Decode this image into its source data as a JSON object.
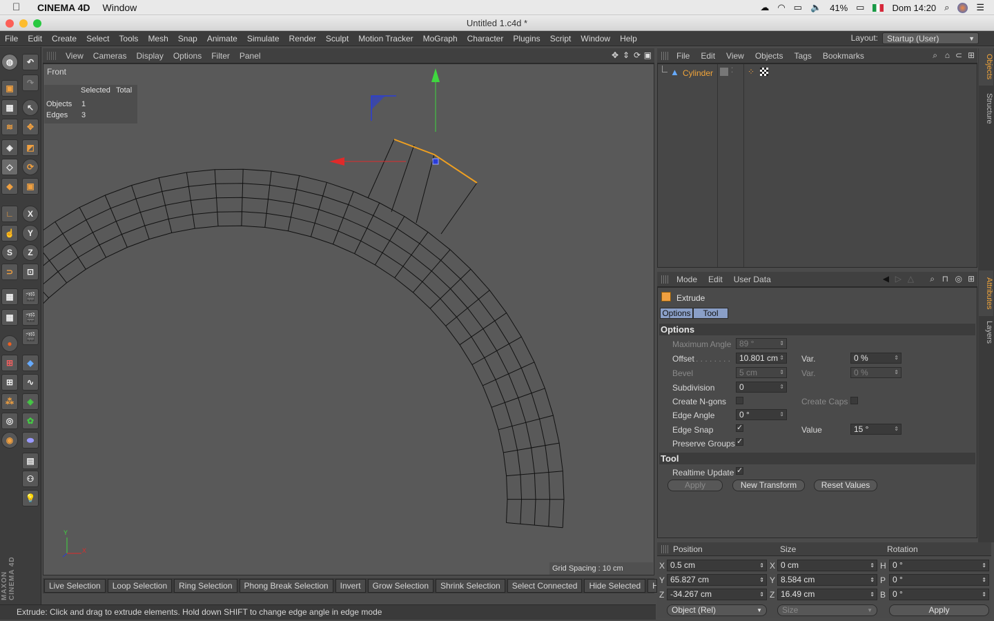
{
  "macos": {
    "app_name": "CINEMA 4D",
    "menu": [
      "Window"
    ],
    "battery": "41%",
    "clock": "Dom 14:20"
  },
  "window": {
    "title": "Untitled 1.c4d *"
  },
  "app_menu": {
    "items": [
      "File",
      "Edit",
      "Create",
      "Select",
      "Tools",
      "Mesh",
      "Snap",
      "Animate",
      "Simulate",
      "Render",
      "Sculpt",
      "Motion Tracker",
      "MoGraph",
      "Character",
      "Plugins",
      "Script",
      "Window",
      "Help"
    ],
    "layout_label": "Layout:",
    "layout_value": "Startup (User)"
  },
  "viewport": {
    "menu": [
      "View",
      "Cameras",
      "Display",
      "Options",
      "Filter",
      "Panel"
    ],
    "name": "Front",
    "stats": {
      "header_selected": "Selected",
      "header_total": "Total",
      "rows": [
        {
          "label": "Objects",
          "selected": "1"
        },
        {
          "label": "Edges",
          "selected": "3"
        }
      ]
    },
    "grid_spacing": "Grid Spacing : 10 cm",
    "axis_y": "Y",
    "axis_x": "X"
  },
  "selection_toolbar": [
    "Live Selection",
    "Loop Selection",
    "Ring Selection",
    "Phong Break Selection",
    "Invert",
    "Grow Selection",
    "Shrink Selection",
    "Select Connected",
    "Hide Selected",
    "Hide"
  ],
  "status_bar": "Extrude: Click and drag to extrude elements. Hold down SHIFT to change edge angle in edge mode",
  "object_manager": {
    "menu": [
      "File",
      "Edit",
      "View",
      "Objects",
      "Tags",
      "Bookmarks"
    ],
    "objects": [
      {
        "name": "Cylinder"
      }
    ]
  },
  "attributes": {
    "menu": [
      "Mode",
      "Edit",
      "User Data"
    ],
    "tool_name": "Extrude",
    "tabs": [
      "Options",
      "Tool"
    ],
    "section_options": "Options",
    "section_tool": "Tool",
    "params": {
      "max_angle_label": "Maximum Angle",
      "max_angle": "89 °",
      "offset_label": "Offset",
      "offset": "10.801 cm",
      "offset_var_label": "Var.",
      "offset_var": "0 %",
      "bevel_label": "Bevel",
      "bevel": "5 cm",
      "bevel_var_label": "Var.",
      "bevel_var": "0 %",
      "subdivision_label": "Subdivision",
      "subdivision": "0",
      "create_ngons_label": "Create N-gons",
      "create_caps_label": "Create Caps",
      "edge_angle_label": "Edge Angle",
      "edge_angle": "0 °",
      "edge_snap_label": "Edge Snap",
      "edge_snap_value_label": "Value",
      "edge_snap_value": "15 °",
      "preserve_groups_label": "Preserve Groups",
      "realtime_update_label": "Realtime Update"
    },
    "buttons": {
      "apply": "Apply",
      "new_transform": "New Transform",
      "reset_values": "Reset Values"
    }
  },
  "coordinates": {
    "head_position": "Position",
    "head_size": "Size",
    "head_rotation": "Rotation",
    "rows": [
      {
        "axis": "X",
        "pos": "0.5 cm",
        "size_axis": "X",
        "size": "0 cm",
        "rot_axis": "H",
        "rot": "0 °"
      },
      {
        "axis": "Y",
        "pos": "65.827 cm",
        "size_axis": "Y",
        "size": "8.584 cm",
        "rot_axis": "P",
        "rot": "0 °"
      },
      {
        "axis": "Z",
        "pos": "-34.267 cm",
        "size_axis": "Z",
        "size": "16.49 cm",
        "rot_axis": "B",
        "rot": "0 °"
      }
    ],
    "mode": "Object (Rel)",
    "size_mode": "Size",
    "apply": "Apply"
  },
  "side_tabs": [
    "Objects",
    "Structure",
    "Attributes",
    "Layers"
  ],
  "colors": {
    "accent_orange": "#f2a53a",
    "axis_y": "#3fd83f",
    "axis_x": "#e02a2a",
    "selected_edge": "#f0a020"
  }
}
